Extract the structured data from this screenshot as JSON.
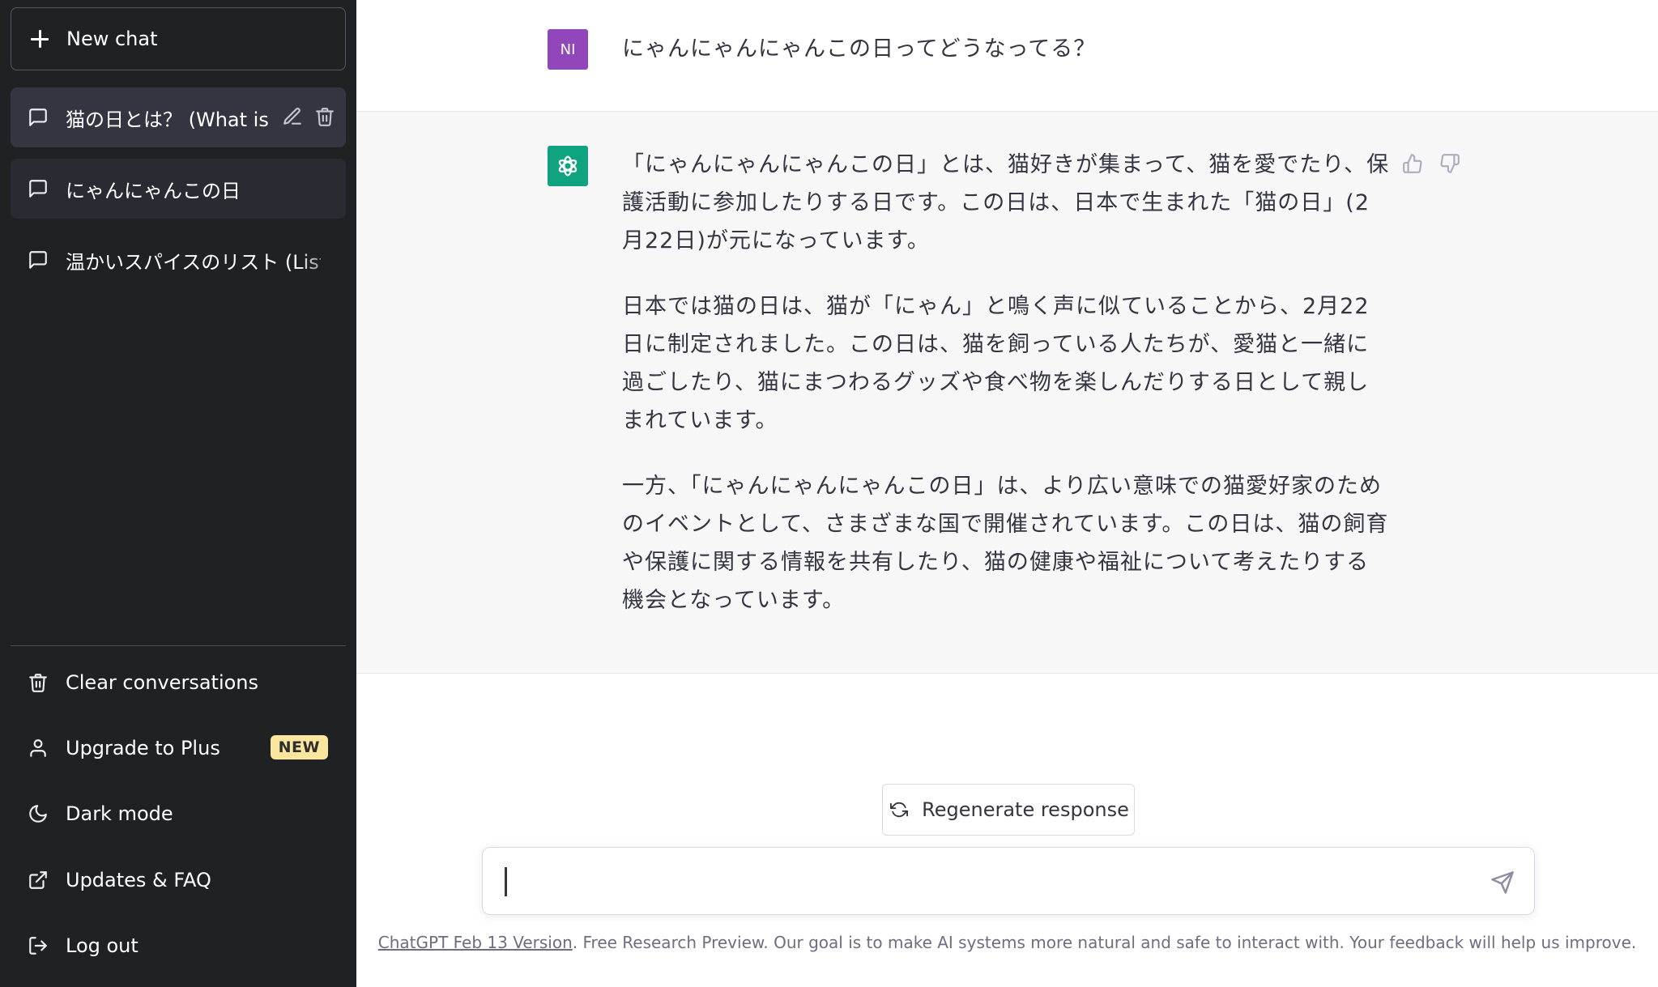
{
  "sidebar": {
    "new_chat_label": "New chat",
    "conversations": [
      {
        "label": "猫の日とは？ (What is",
        "active": true
      },
      {
        "label": "にゃんにゃんこの日",
        "active": false
      },
      {
        "label": "温かいスパイスのリスト (List",
        "active": false
      }
    ],
    "menu": {
      "clear": "Clear conversations",
      "upgrade": "Upgrade to Plus",
      "upgrade_badge": "NEW",
      "dark_mode": "Dark mode",
      "updates": "Updates & FAQ",
      "logout": "Log out"
    }
  },
  "chat": {
    "user_avatar": "NI",
    "user_message": "にゃんにゃんにゃんこの日ってどうなってる？",
    "assistant_paragraphs": [
      "「にゃんにゃんにゃんこの日」とは、猫好きが集まって、猫を愛でたり、保護活動に参加したりする日です。この日は、日本で生まれた「猫の日」(2月22日)が元になっています。",
      "日本では猫の日は、猫が「にゃん」と鳴く声に似ていることから、2月22日に制定されました。この日は、猫を飼っている人たちが、愛猫と一緒に過ごしたり、猫にまつわるグッズや食べ物を楽しんだりする日として親しまれています。",
      "一方、「にゃんにゃんにゃんこの日」は、より広い意味での猫愛好家のためのイベントとして、さまざまな国で開催されています。この日は、猫の飼育や保護に関する情報を共有したり、猫の健康や福祉について考えたりする機会となっています。"
    ]
  },
  "composer": {
    "regenerate_label": "Regenerate response",
    "input_value": ""
  },
  "footer": {
    "link_text": "ChatGPT Feb 13 Version",
    "text": ". Free Research Preview. Our goal is to make AI systems more natural and safe to interact with. Your feedback will help us improve."
  },
  "colors": {
    "sidebar_bg": "#202123",
    "assistant_bg": "#f7f7f8",
    "user_avatar_bg": "#9146ba",
    "assistant_avatar_bg": "#10a37f",
    "badge_bg": "#fae69e"
  }
}
